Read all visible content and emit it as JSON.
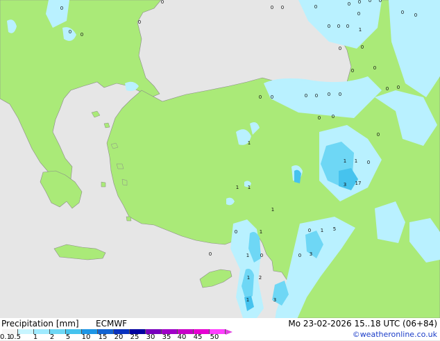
{
  "footer": {
    "title": "Precipitation [mm]",
    "model": "ECMWF",
    "valid_time": "Mo 23-02-2026 15..18 UTC (06+84)",
    "credit": "©weatheronline.co.uk"
  },
  "legend": {
    "tick_labels": [
      "0.1",
      "0.5",
      "1",
      "2",
      "5",
      "10",
      "15",
      "20",
      "25",
      "30",
      "35",
      "40",
      "45",
      "50"
    ],
    "colors": [
      "#f5f5f5",
      "#c8f5ff",
      "#a0ebff",
      "#6ed7f5",
      "#46c3ee",
      "#1e96e6",
      "#1464d2",
      "#0a32be",
      "#0000a0",
      "#7800be",
      "#a000c8",
      "#c800c8",
      "#e600d2",
      "#ff40ff"
    ]
  },
  "map_labels": [
    {
      "text": "0"
    },
    {
      "text": "0"
    },
    {
      "text": "0"
    },
    {
      "text": "0"
    },
    {
      "text": "0"
    },
    {
      "text": "0"
    },
    {
      "text": "0"
    },
    {
      "text": "0"
    },
    {
      "text": "0"
    },
    {
      "text": "0"
    },
    {
      "text": "0"
    },
    {
      "text": "0"
    },
    {
      "text": "0"
    },
    {
      "text": "0"
    },
    {
      "text": "0"
    },
    {
      "text": "0"
    },
    {
      "text": "0"
    },
    {
      "text": "1"
    },
    {
      "text": "0"
    },
    {
      "text": "0"
    },
    {
      "text": "0"
    },
    {
      "text": "0"
    },
    {
      "text": "0"
    },
    {
      "text": "0"
    },
    {
      "text": "0"
    },
    {
      "text": "0"
    },
    {
      "text": "0"
    },
    {
      "text": "0"
    },
    {
      "text": "0"
    },
    {
      "text": "0"
    },
    {
      "text": "0"
    },
    {
      "text": "0"
    },
    {
      "text": "0"
    },
    {
      "text": "1"
    },
    {
      "text": "1"
    },
    {
      "text": "1"
    },
    {
      "text": "0"
    },
    {
      "text": "1"
    },
    {
      "text": "1"
    },
    {
      "text": "3"
    },
    {
      "text": "17"
    },
    {
      "text": "0"
    },
    {
      "text": "1"
    },
    {
      "text": "0"
    },
    {
      "text": "0"
    },
    {
      "text": "1"
    },
    {
      "text": "5"
    },
    {
      "text": "1"
    },
    {
      "text": "0"
    },
    {
      "text": "0"
    },
    {
      "text": "3"
    },
    {
      "text": "0"
    },
    {
      "text": "1"
    },
    {
      "text": "2"
    },
    {
      "text": "1"
    },
    {
      "text": "1"
    },
    {
      "text": "3"
    }
  ]
}
